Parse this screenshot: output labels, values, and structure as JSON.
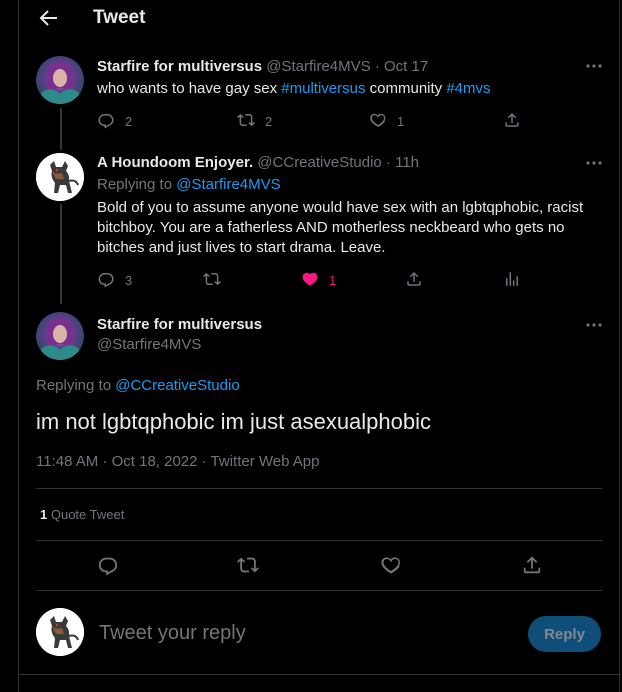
{
  "header": {
    "title": "Tweet"
  },
  "tweet1": {
    "name": "Starfire for multiversus",
    "handle": "@Starfire4MVS",
    "sep": "·",
    "time": "Oct 17",
    "text_pre": "who wants to have gay sex ",
    "hashtag1": "#multiversus",
    "text_mid": " community ",
    "hashtag2": "#4mvs",
    "replies": "2",
    "retweets": "2",
    "likes": "1"
  },
  "tweet2": {
    "name": "A Houndoom Enjoyer.",
    "handle": "@CCreativeStudio",
    "sep": "·",
    "time": "11h",
    "replying_label": "Replying to ",
    "replying_to": "@Starfire4MVS",
    "text": "Bold of you to assume anyone would have sex with an lgbtqphobic, racist bitchboy. You are a fatherless AND motherless neckbeard who gets no bitches and just lives to start drama. Leave.",
    "replies": "3",
    "likes": "1"
  },
  "main_tweet": {
    "name": "Starfire for multiversus",
    "handle": "@Starfire4MVS",
    "replying_label": "Replying to ",
    "replying_to": "@CCreativeStudio",
    "text": "im not lgbtqphobic im just asexualphobic",
    "timestamp": "11:48 AM · Oct 18, 2022 · Twitter Web App",
    "quote_count": "1",
    "quote_label": " Quote Tweet"
  },
  "compose": {
    "placeholder": "Tweet your reply",
    "button": "Reply"
  },
  "colors": {
    "background": "#000000",
    "text": "#e7e9ea",
    "secondary": "#71767b",
    "link": "#1d9bf0",
    "like": "#f91880",
    "divider": "#2f3336",
    "reply_button": "#0f4e78"
  },
  "icons": [
    "back-arrow-icon",
    "more-icon",
    "reply-icon",
    "retweet-icon",
    "like-icon",
    "share-icon",
    "analytics-icon"
  ]
}
